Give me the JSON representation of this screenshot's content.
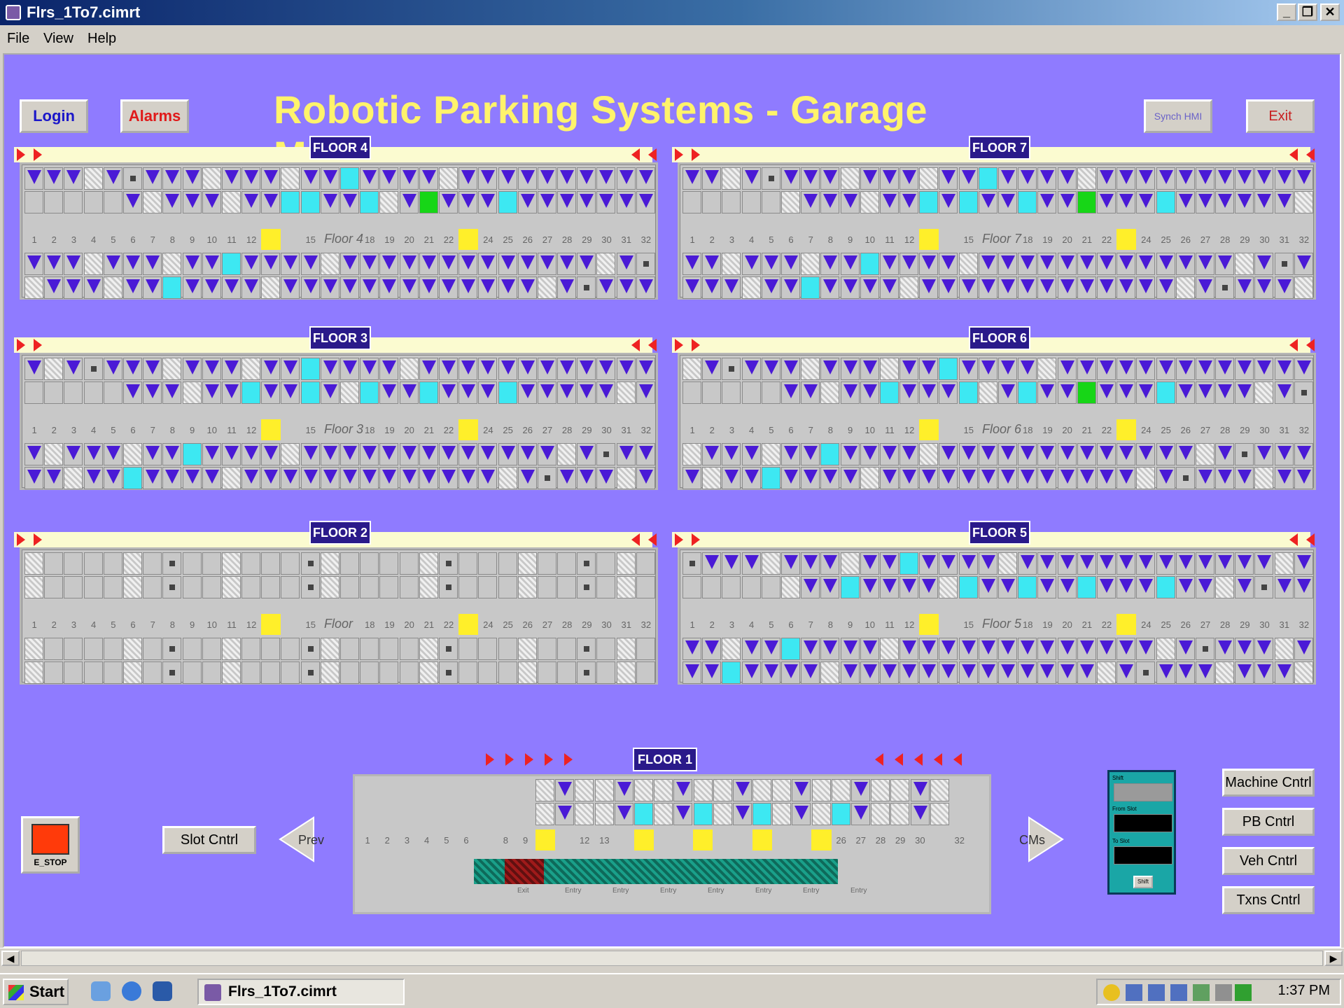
{
  "window": {
    "title": "Flrs_1To7.cimrt"
  },
  "menu": [
    "File",
    "View",
    "Help"
  ],
  "header": {
    "title": "Robotic Parking Systems - Garage Manager",
    "login": "Login",
    "alarms": "Alarms",
    "synch": "Synch HMI",
    "exit": "Exit"
  },
  "floors": [
    {
      "label": "FLOOR 4",
      "name": "Floor 4"
    },
    {
      "label": "FLOOR 7",
      "name": "Floor 7"
    },
    {
      "label": "FLOOR 3",
      "name": "Floor 3"
    },
    {
      "label": "FLOOR 6",
      "name": "Floor 6"
    },
    {
      "label": "FLOOR 2",
      "name": "Floor"
    },
    {
      "label": "FLOOR 5",
      "name": "Floor 5"
    }
  ],
  "slot_numbers": [
    "1",
    "2",
    "3",
    "4",
    "5",
    "6",
    "7",
    "8",
    "9",
    "10",
    "11",
    "12",
    "",
    "",
    "15",
    "",
    "",
    "18",
    "19",
    "20",
    "21",
    "22",
    "",
    "24",
    "25",
    "26",
    "27",
    "28",
    "29",
    "30",
    "31",
    "32"
  ],
  "floor1": {
    "label": "FLOOR 1",
    "numbers": [
      "1",
      "2",
      "3",
      "4",
      "5",
      "6",
      "",
      "8",
      "9",
      "",
      "",
      "12",
      "13",
      "",
      "",
      "",
      "",
      "",
      "",
      "",
      "",
      "",
      "",
      "",
      "26",
      "27",
      "28",
      "29",
      "30",
      "",
      "32"
    ],
    "bottom_labels": [
      "Exit",
      "Entry",
      "Entry",
      "Entry",
      "Entry",
      "Entry",
      "Entry",
      "Entry"
    ]
  },
  "controls": {
    "estop": "E_STOP",
    "slot": "Slot Cntrl",
    "prev": "Prev",
    "cms": "CMs",
    "machine": "Machine Cntrl",
    "pb": "PB Cntrl",
    "veh": "Veh Cntrl",
    "txns": "Txns Cntrl",
    "shift_title": "Shift",
    "from_slot": "From Slot",
    "to_slot": "To Slot",
    "shift_btn": "Shift"
  },
  "taskbar": {
    "start": "Start",
    "task": "Flrs_1To7.cimrt",
    "clock": "1:37 PM"
  },
  "colors": {
    "background": "#8f7bff",
    "title": "#fff36b",
    "car": "#4a1ad6",
    "cyan": "#3de8f2",
    "green": "#17d617",
    "yellow": "#ffef2a"
  }
}
